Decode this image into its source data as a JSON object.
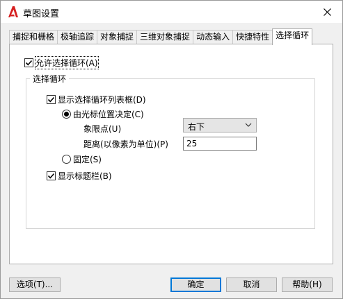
{
  "window": {
    "title": "草图设置",
    "close_icon": "close-icon",
    "app_icon": "autocad-a-icon",
    "accent_color": "#d62020"
  },
  "tabs": [
    {
      "label": "捕捉和栅格"
    },
    {
      "label": "极轴追踪"
    },
    {
      "label": "对象捕捉"
    },
    {
      "label": "三维对象捕捉"
    },
    {
      "label": "动态输入"
    },
    {
      "label": "快捷特性"
    },
    {
      "label": "选择循环",
      "active": true
    }
  ],
  "panel": {
    "enable_cycling": {
      "label": "允许选择循环(A)",
      "checked": true
    },
    "group_title": "选择循环",
    "show_list_box": {
      "label": "显示选择循环列表框(D)",
      "checked": true
    },
    "cursor_position": {
      "label": "由光标位置决定(C)",
      "selected": true
    },
    "quadrant": {
      "label": "象限点(U)",
      "value": "右下"
    },
    "distance": {
      "label": "距离(以像素为单位)(P)",
      "value": "25"
    },
    "fixed": {
      "label": "固定(S)",
      "selected": false
    },
    "show_titlebar": {
      "label": "显示标题栏(B)",
      "checked": true
    }
  },
  "buttons": {
    "options": "选项(T)...",
    "ok": "确定",
    "cancel": "取消",
    "help": "帮助(H)"
  }
}
